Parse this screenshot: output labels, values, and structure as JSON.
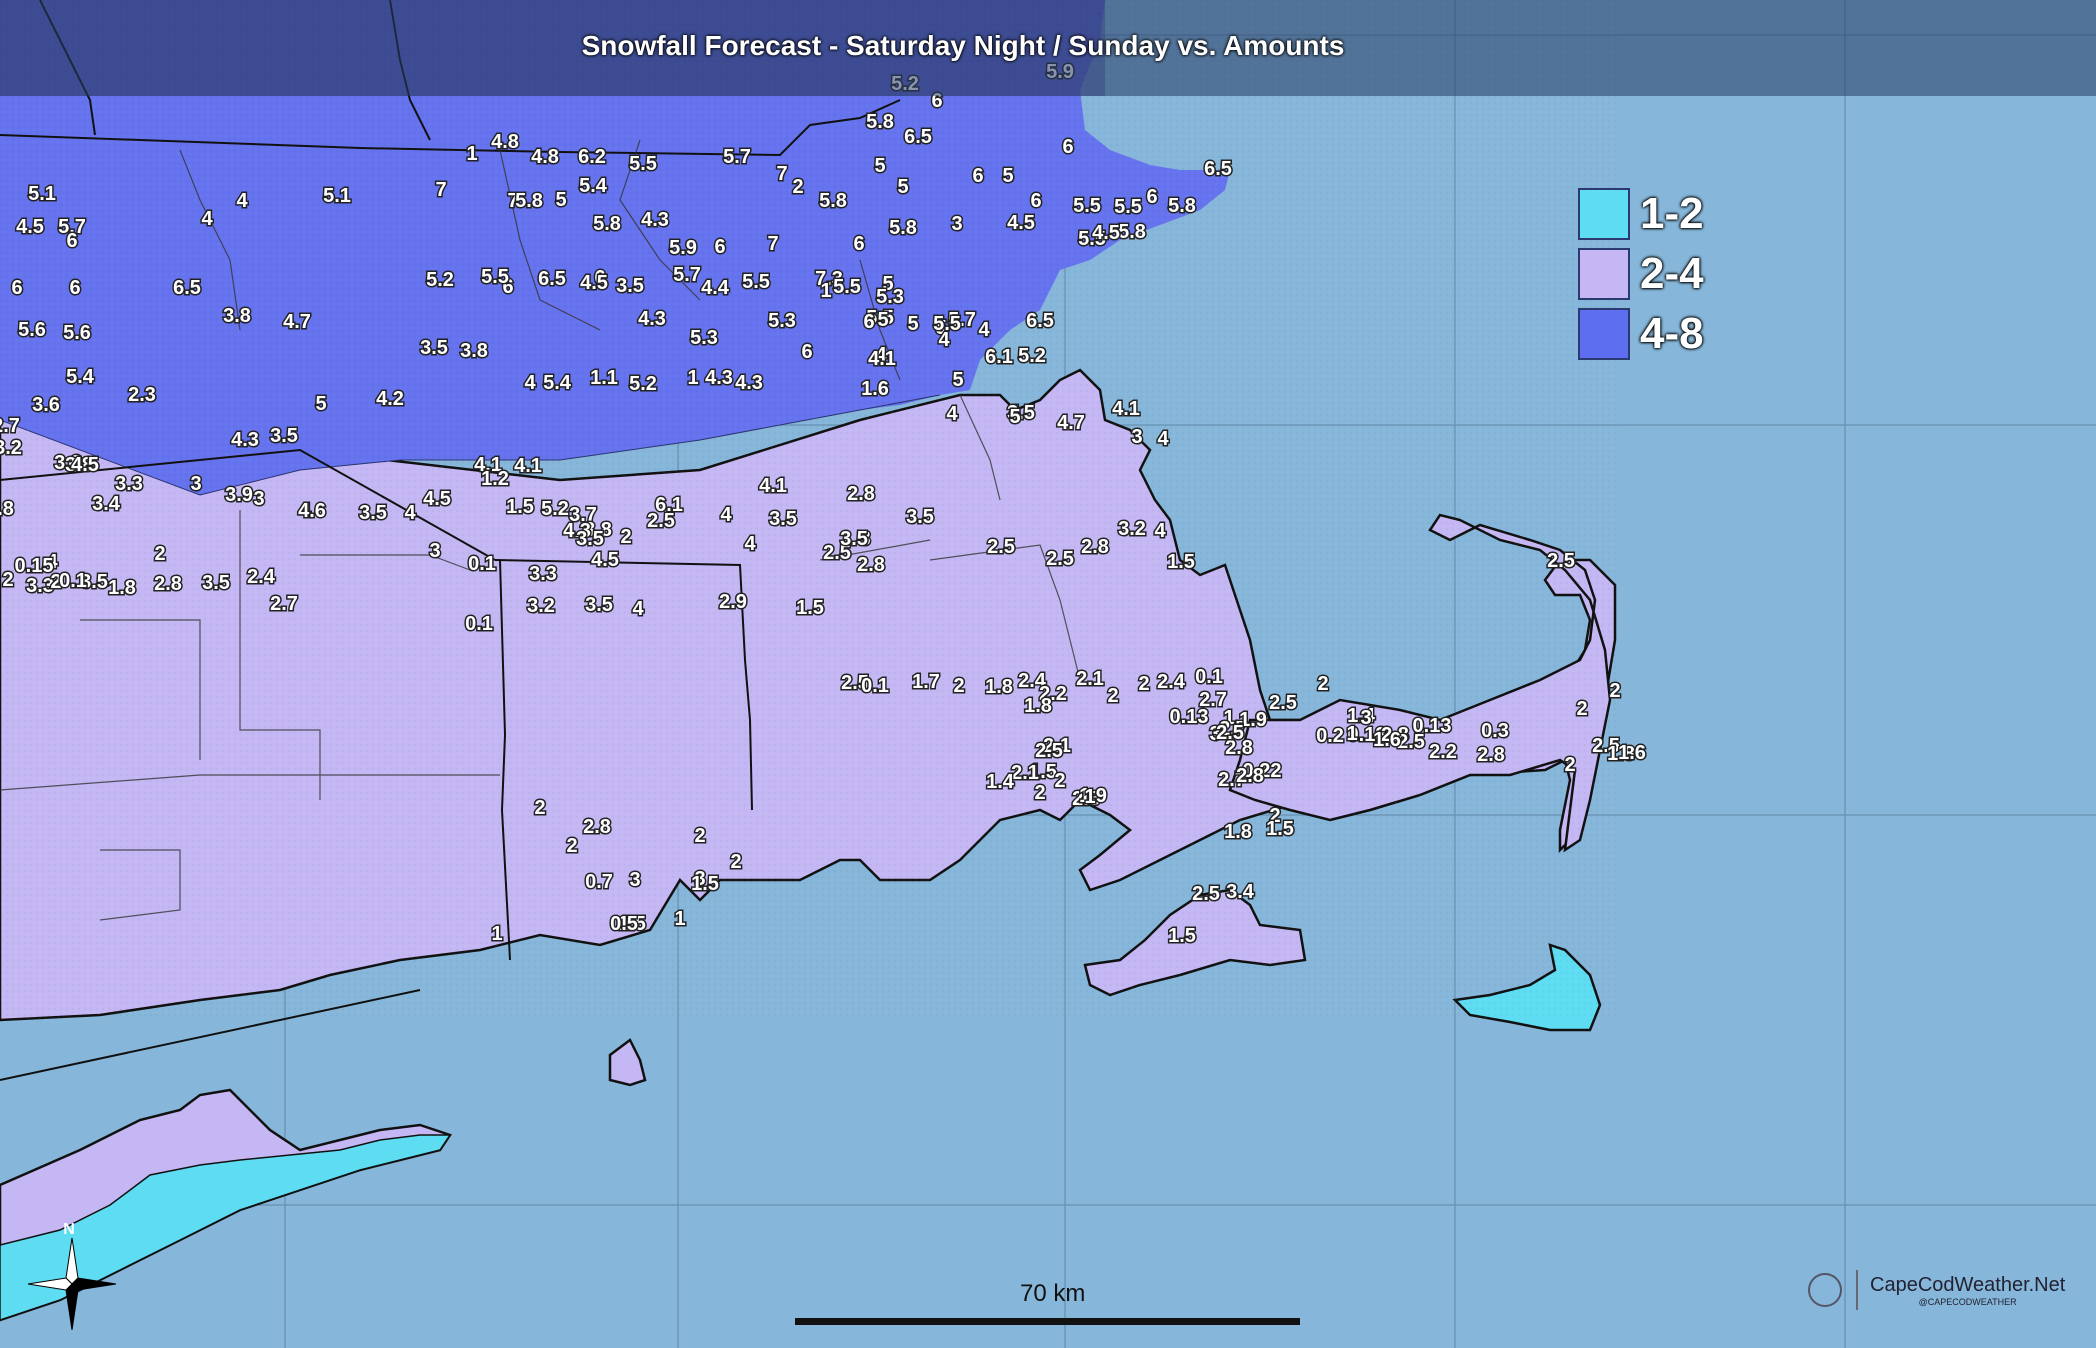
{
  "title": "Snowfall Forecast - Saturday Night / Sunday vs. Amounts",
  "legend": [
    {
      "label": "1-2",
      "color": "#5ddcf2"
    },
    {
      "label": "2-4",
      "color": "#c4b7f4"
    },
    {
      "label": "4-8",
      "color": "#5e6ef0"
    }
  ],
  "colors": {
    "water": "#86b6d9",
    "band_1_2": "#5ddcf2",
    "band_2_4": "#c4b7f4",
    "band_4_8": "#6673ee",
    "band_top": "#5a5fb8"
  },
  "scale": {
    "label": "70 km"
  },
  "credit": {
    "name": "CapeCodWeather.Net",
    "handle": "@CAPECODWEATHER"
  },
  "compass": {
    "label": "N"
  },
  "observations": [
    "5.2",
    "6",
    "5.9",
    "5.8",
    "6.5",
    "1",
    "4.8",
    "4.8",
    "6.2",
    "5.5",
    "5.7",
    "7",
    "2",
    "5.8",
    "5",
    "5",
    "6",
    "5",
    "6",
    "6",
    "5.5",
    "5.5",
    "6",
    "6.5",
    "5.8",
    "5.5",
    "5.8",
    "5.1",
    "4.5",
    "4",
    "4",
    "5.1",
    "7",
    "7",
    "5.8",
    "5",
    "5.4",
    "5.8",
    "4.3",
    "5.9",
    "6",
    "7",
    "6",
    "5.8",
    "3",
    "4.5",
    "4.5",
    "5.7",
    "6",
    "6.5",
    "5.2",
    "6",
    "6",
    "5.5",
    "6.5",
    "4.5",
    "3.5",
    "5.7",
    "4.4",
    "5.5",
    "7.3",
    "5",
    "5.3",
    "5.5",
    "5",
    "5",
    "5",
    "5.7",
    "6.5",
    "6",
    "6",
    "5.6",
    "5.6",
    "3.8",
    "4.7",
    "3.5",
    "3.8",
    "4.3",
    "5.3",
    "5.3",
    "1",
    "5.5",
    "6",
    "4",
    "4",
    "6.1",
    "5.2",
    "5.4",
    "3.6",
    "2.3",
    "5",
    "4.2",
    "4",
    "5.4",
    "1.1",
    "5.2",
    "1",
    "4.3",
    "4.3",
    "6",
    "4",
    "4.1",
    "4",
    "5.5",
    "1.6",
    "5",
    "4",
    "3.5",
    "5",
    "4.1",
    "4.7",
    "3",
    "4",
    "2.7",
    "4.3",
    "3.5",
    "3.2",
    "3.3",
    "3.8",
    "4.5",
    "3.3",
    "3",
    "3",
    "3.9",
    "4",
    "4.6",
    "3.5",
    "4",
    "4.5",
    "4.1",
    "4.1",
    "1.2",
    "5.2",
    "1.5",
    "3.7",
    "3.8",
    "4.3",
    "3.5",
    "2.5",
    "2",
    "4",
    "6.1",
    "4.5",
    "4.1",
    "3.5",
    "4",
    "2.5",
    "2.8",
    "3",
    "3.5",
    "3.5",
    "2.8",
    "2.5",
    "2.5",
    "2.8",
    "1.5",
    "3.2",
    "4",
    "3.8",
    "3.4",
    "2",
    "3.3",
    "4",
    "3.5",
    "2",
    "0.15",
    "0.1",
    "1.8",
    "2.8",
    "2",
    "3.5",
    "2.4",
    "2.7",
    "3",
    "0.1",
    "0.1",
    "3.3",
    "3.2",
    "3.5",
    "4",
    "2.9",
    "1.5",
    "2.5",
    "0.1",
    "1.7",
    "2",
    "1.8",
    "2.4",
    "2.1",
    "2",
    "2.4",
    "0.1",
    "2.7",
    "3",
    "1",
    "2.7",
    "1.9",
    "2.5",
    "2",
    "1.4",
    "3",
    "0.13",
    "2.8",
    "0.13",
    "0.3",
    "2",
    "2.5",
    "1.8",
    "1.6",
    "2",
    "2",
    "2.8",
    "2.2",
    "2.5",
    "1.6",
    "1",
    "0.2",
    "0.22",
    "2.8",
    "2.5",
    "0.13",
    "2",
    "2.2",
    "1.8",
    "1.5",
    "2.1",
    "2.8",
    "1.9",
    "2",
    "2",
    "1",
    "2.1",
    "1.4",
    "2.5",
    "2.7",
    "2.8",
    "2",
    "1.8",
    "1.5",
    "2",
    "2.8",
    "2",
    "0.7",
    "3",
    "2",
    "3",
    "2",
    "1.5",
    "1.5",
    "0.5",
    "1",
    "1",
    "2.5",
    "3.4",
    "1.5",
    "2.5",
    "1.9",
    "1.8",
    "0.5",
    "2.6"
  ]
}
